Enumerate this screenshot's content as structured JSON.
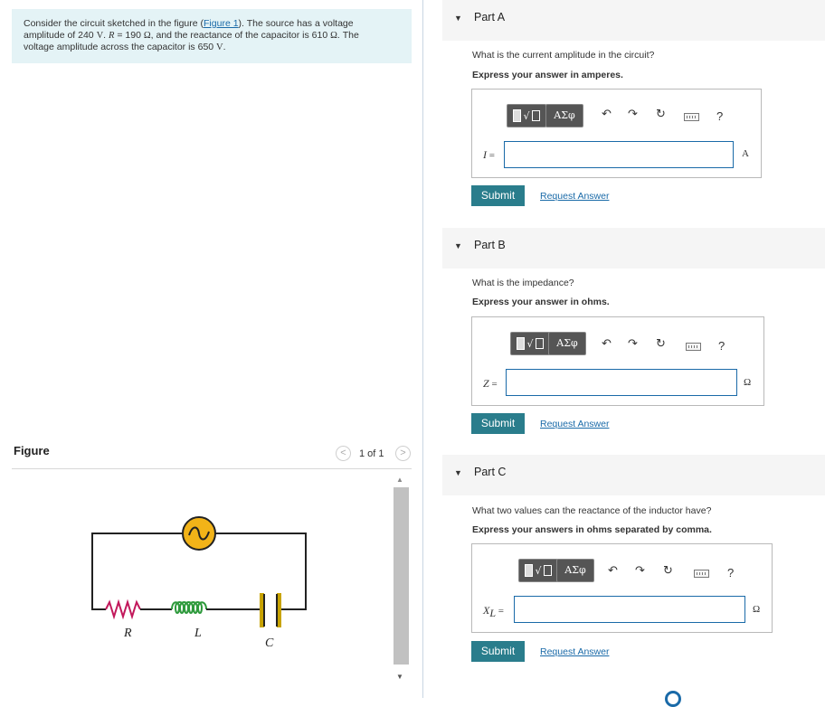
{
  "problem": {
    "pre_link": "Consider the circuit sketched in the figure (",
    "link": "Figure 1",
    "post_link": "). The source has a voltage",
    "line2_a": "amplitude of 240 ",
    "line2_V": "V",
    "line2_b": ". ",
    "line2_R": "R",
    "line2_c": " = 190 ",
    "line2_ohm": "Ω",
    "line2_d": ", and the reactance of the capacitor is 610 ",
    "line2_ohm2": "Ω",
    "line2_e": ". The",
    "line3_a": "voltage amplitude across the capacitor is 650 ",
    "line3_V": "V",
    "line3_b": "."
  },
  "figure": {
    "label": "Figure",
    "pager": "1 of 1",
    "prev": "<",
    "next": ">",
    "circuit_labels": {
      "R": "R",
      "L": "L",
      "C": "C"
    }
  },
  "toolbar": {
    "greek": "ΑΣφ",
    "undo": "↶",
    "redo": "↷",
    "reset": "↻",
    "help": "?"
  },
  "parts": [
    {
      "title": "Part A",
      "question": "What is the current amplitude in the circuit?",
      "express": "Express your answer in amperes.",
      "var": "I",
      "eq": " =",
      "value": "",
      "unit": "A",
      "submit": "Submit",
      "request": "Request Answer"
    },
    {
      "title": "Part B",
      "question": "What is the impedance?",
      "express": "Express your answer in ohms.",
      "var": "Z",
      "eq": " =",
      "value": "",
      "unit": "Ω",
      "submit": "Submit",
      "request": "Request Answer"
    },
    {
      "title": "Part C",
      "question": "What two values can the reactance of the inductor have?",
      "express": "Express your answers in ohms separated by comma.",
      "var": "X",
      "var_sub": "L",
      "eq": " =",
      "value": "",
      "unit": "Ω",
      "submit": "Submit",
      "request": "Request Answer"
    }
  ],
  "colors": {
    "problem_bg": "#e4f3f6",
    "submit_bg": "#2a7d8c",
    "link": "#1a6aa8",
    "capacitor": "#c8a300"
  }
}
